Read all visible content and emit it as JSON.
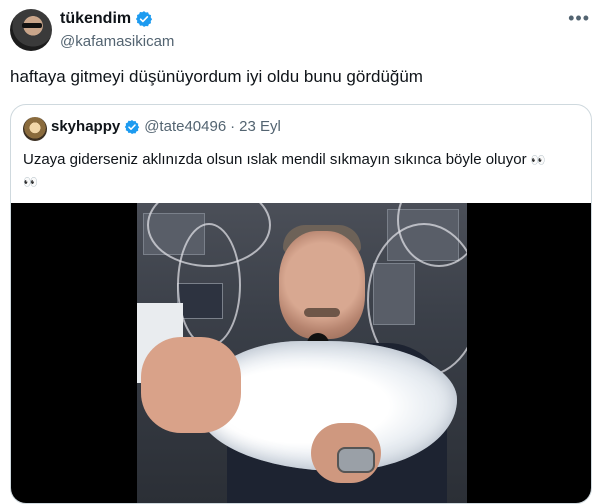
{
  "tweet": {
    "author": {
      "display_name": "tükendim",
      "handle": "@kafamasikicam",
      "verified": true,
      "avatar": "avatar-photo"
    },
    "text": "haftaya gitmeyi düşünüyordum iyi oldu bunu gördüğüm",
    "more_icon": "ellipsis-icon",
    "more_symbol": "•••"
  },
  "quoted_tweet": {
    "author": {
      "display_name": "skyhappy",
      "handle": "@tate40496",
      "verified": true,
      "avatar": "avatar-photo"
    },
    "separator": "·",
    "date": "23 Eyl",
    "text": "Uzaya giderseniz aklınızda olsun ıslak mendil sıkmayın sıkınca böyle oluyor",
    "emoji_line1": "👀",
    "emoji_line2": "👀",
    "media": {
      "type": "video-still",
      "description_icon": "video-thumbnail"
    }
  },
  "colors": {
    "text_primary": "#0f1419",
    "text_secondary": "#536471",
    "verified_blue": "#1d9bf0",
    "border": "#cfd9de",
    "media_background": "#000000"
  }
}
